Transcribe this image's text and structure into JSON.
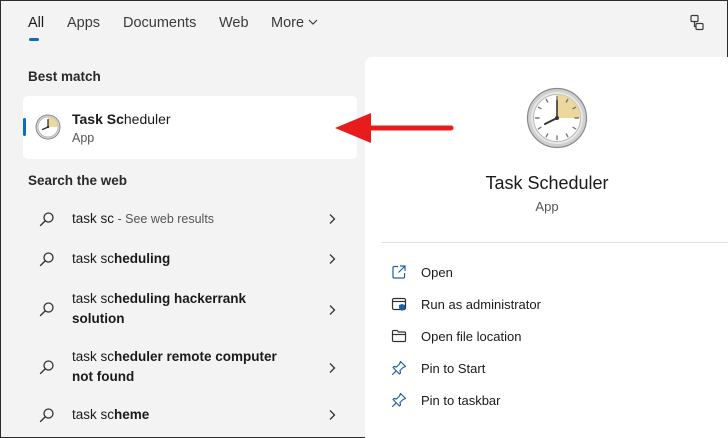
{
  "tabs": [
    {
      "label": "All"
    },
    {
      "label": "Apps"
    },
    {
      "label": "Documents"
    },
    {
      "label": "Web"
    },
    {
      "label": "More"
    }
  ],
  "best_match": {
    "heading": "Best match",
    "title_bold": "Task Sc",
    "title_rest": "heduler",
    "subtitle": "App"
  },
  "web": {
    "heading": "Search the web",
    "items": [
      {
        "plain": "task sc",
        "bold": "",
        "hint": " - See web results"
      },
      {
        "plain": "task sc",
        "bold": "heduling",
        "hint": ""
      },
      {
        "plain": "task sc",
        "bold": "heduling hackerrank solution",
        "hint": ""
      },
      {
        "plain": "task sc",
        "bold": "heduler remote computer not found",
        "hint": ""
      },
      {
        "plain": "task sc",
        "bold": "heme",
        "hint": ""
      }
    ]
  },
  "detail": {
    "title": "Task Scheduler",
    "subtitle": "App",
    "actions": [
      {
        "label": "Open",
        "icon": "open-icon"
      },
      {
        "label": "Run as administrator",
        "icon": "shield-admin-icon"
      },
      {
        "label": "Open file location",
        "icon": "folder-icon"
      },
      {
        "label": "Pin to Start",
        "icon": "pin-icon"
      },
      {
        "label": "Pin to taskbar",
        "icon": "pin-icon"
      }
    ]
  },
  "colors": {
    "accent": "#0f6cbd",
    "annotation_arrow": "#e81c1c",
    "background": "#f3f3f3",
    "panel": "#ffffff"
  }
}
